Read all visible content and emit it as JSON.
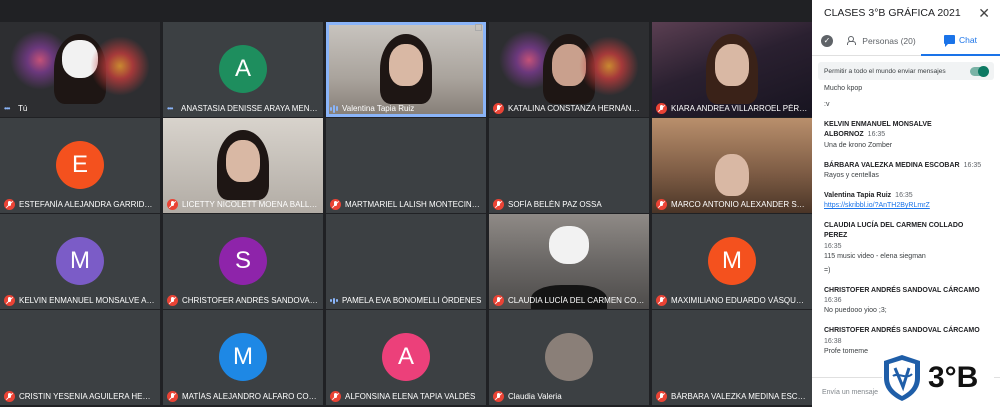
{
  "participants": [
    {
      "name": "Tú",
      "status": "speaking-dots"
    },
    {
      "name": "ANASTASIA DENISSE ARAYA MENESES",
      "status": "speaking-dots",
      "initial": "A"
    },
    {
      "name": "Valentina Tapia Ruiz",
      "status": "speaking"
    },
    {
      "name": "KATALINA CONSTANZA HERNÁNDEZ R...",
      "status": "muted"
    },
    {
      "name": "KIARA ANDREA VILLARROEL PÉREZ",
      "status": "muted"
    },
    {
      "name": "ESTEFANÍA ALEJANDRA GARRIDO ALVE...",
      "status": "muted",
      "initial": "E"
    },
    {
      "name": "LICETTY NICOLETT MOENA BALLADAR...",
      "status": "muted"
    },
    {
      "name": "MARTMARIEL LALISH MONTECINOS NA...",
      "status": "muted"
    },
    {
      "name": "SOFÍA BELÉN PAZ OSSA",
      "status": "muted"
    },
    {
      "name": "MARCO ANTONIO ALEXANDER SAA MA...",
      "status": "muted"
    },
    {
      "name": "KELVIN ENMANUEL MONSALVE ALBOR...",
      "status": "muted",
      "initial": "M"
    },
    {
      "name": "CHRISTOFER ANDRÉS SANDOVAL CÁR...",
      "status": "muted",
      "initial": "S"
    },
    {
      "name": "PAMELA EVA BONOMELLI ÓRDENES",
      "status": "speaking-bars"
    },
    {
      "name": "CLAUDIA LUCÍA DEL CARMEN COLLAD...",
      "status": "muted"
    },
    {
      "name": "MAXIMILIANO EDUARDO VÁSQUEZ COL...",
      "status": "muted",
      "initial": "M"
    },
    {
      "name": "CRISTIN YESENIA AGUILERA HERNÁND...",
      "status": "muted"
    },
    {
      "name": "MATÍAS ALEJANDRO ALFARO CONTRE...",
      "status": "muted",
      "initial": "M"
    },
    {
      "name": "ALFONSINA ELENA TAPIA VALDÉS",
      "status": "muted",
      "initial": "A"
    },
    {
      "name": "Claudia Valeria",
      "status": "muted"
    },
    {
      "name": "BÁRBARA VALEZKA MEDINA ESCOBAR",
      "status": "muted"
    }
  ],
  "colors": {
    "avatar_green": "#1e8e5e",
    "avatar_orange": "#f4511e",
    "avatar_purple": "#7b5cc7",
    "avatar_violet": "#8e24aa",
    "avatar_blue": "#1e88e5",
    "avatar_pink": "#ec407a",
    "accent": "#1a73e8",
    "muted_red": "#ea4335"
  },
  "sidebar": {
    "title": "CLASES 3°B GRÁFICA 2021",
    "close_icon": "close-icon",
    "tab_people": "Personas (20)",
    "tab_chat": "Chat",
    "allow_messages": "Permitir a todo el mundo enviar mensajes",
    "compose_placeholder": "Envía un mensaje",
    "messages": [
      {
        "lines": [
          "Mucho kpop",
          ":v"
        ]
      },
      {
        "sender": "KELVIN ENMANUEL MONSALVE ALBORNOZ",
        "time": "16:35",
        "lines": [
          "Una de krono Zomber"
        ]
      },
      {
        "sender": "BÁRBARA VALEZKA MEDINA ESCOBAR",
        "time": "16:35",
        "lines": [
          "Rayos y centellas"
        ]
      },
      {
        "sender": "Valentina Tapia Ruiz",
        "time": "16:35",
        "link": "https://skribbl.io/?AnTH2ByRLmrZ"
      },
      {
        "sender": "CLAUDIA LUCÍA DEL CARMEN COLLADO PEREZ",
        "time": "16:35",
        "lines": [
          "115 music video -  elena siegman",
          "=)"
        ]
      },
      {
        "sender": "CHRISTOFER ANDRÉS SANDOVAL CÁRCAMO",
        "time": "16:36",
        "lines": [
          "No puedooo yioo ;3;"
        ]
      },
      {
        "sender": "CHRISTOFER ANDRÉS SANDOVAL CÁRCAMO",
        "time": "16:38",
        "lines": [
          "Profe tomeme"
        ]
      }
    ]
  },
  "logo": {
    "text": "3°B"
  }
}
